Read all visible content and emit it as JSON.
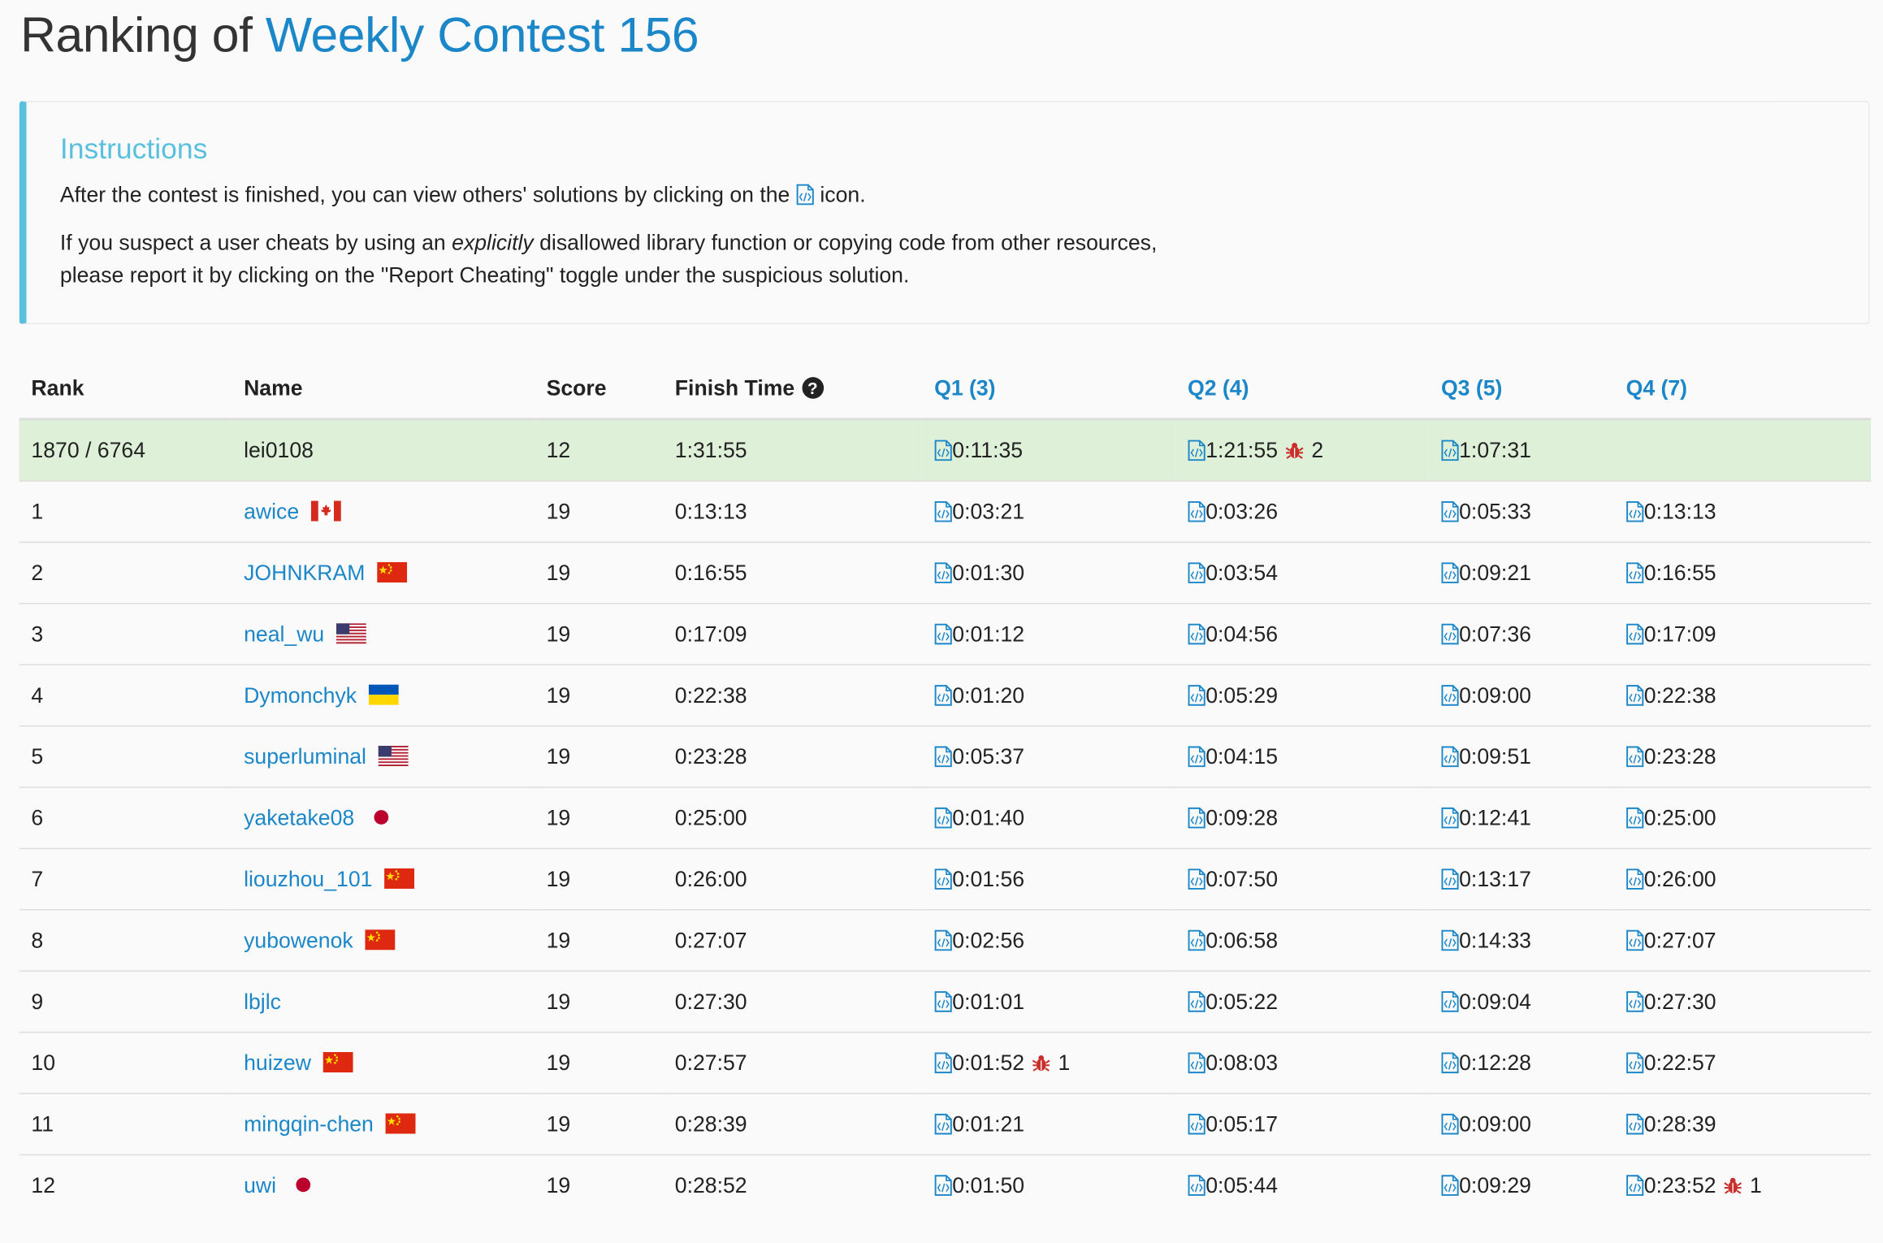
{
  "header": {
    "prefix": "Ranking of",
    "contest_name": "Weekly Contest 156"
  },
  "instructions": {
    "title": "Instructions",
    "line1_before": "After the contest is finished, you can view others' solutions by clicking on the",
    "line1_after": "icon.",
    "line2_before": "If you suspect a user cheats by using an",
    "line2_em": "explicitly",
    "line2_after": "disallowed library function or copying code from other resources,",
    "line3": "please report it by clicking on the \"Report Cheating\" toggle under the suspicious solution."
  },
  "table": {
    "headers": {
      "rank": "Rank",
      "name": "Name",
      "score": "Score",
      "finish": "Finish Time",
      "q1": "Q1 (3)",
      "q2": "Q2 (4)",
      "q3": "Q3 (5)",
      "q4": "Q4 (7)"
    },
    "rows": [
      {
        "rank": "1870 / 6764",
        "name": "lei0108",
        "flag": "",
        "score": "12",
        "finish": "1:31:55",
        "highlight": true,
        "q": [
          {
            "time": "0:11:35",
            "bugs": ""
          },
          {
            "time": "1:21:55",
            "bugs": "2"
          },
          {
            "time": "1:07:31",
            "bugs": ""
          },
          {
            "time": "",
            "bugs": ""
          }
        ]
      },
      {
        "rank": "1",
        "name": "awice",
        "flag": "ca",
        "score": "19",
        "finish": "0:13:13",
        "q": [
          {
            "time": "0:03:21",
            "bugs": ""
          },
          {
            "time": "0:03:26",
            "bugs": ""
          },
          {
            "time": "0:05:33",
            "bugs": ""
          },
          {
            "time": "0:13:13",
            "bugs": ""
          }
        ]
      },
      {
        "rank": "2",
        "name": "JOHNKRAM",
        "flag": "cn",
        "score": "19",
        "finish": "0:16:55",
        "q": [
          {
            "time": "0:01:30",
            "bugs": ""
          },
          {
            "time": "0:03:54",
            "bugs": ""
          },
          {
            "time": "0:09:21",
            "bugs": ""
          },
          {
            "time": "0:16:55",
            "bugs": ""
          }
        ]
      },
      {
        "rank": "3",
        "name": "neal_wu",
        "flag": "us",
        "score": "19",
        "finish": "0:17:09",
        "q": [
          {
            "time": "0:01:12",
            "bugs": ""
          },
          {
            "time": "0:04:56",
            "bugs": ""
          },
          {
            "time": "0:07:36",
            "bugs": ""
          },
          {
            "time": "0:17:09",
            "bugs": ""
          }
        ]
      },
      {
        "rank": "4",
        "name": "Dymonchyk",
        "flag": "ua",
        "score": "19",
        "finish": "0:22:38",
        "q": [
          {
            "time": "0:01:20",
            "bugs": ""
          },
          {
            "time": "0:05:29",
            "bugs": ""
          },
          {
            "time": "0:09:00",
            "bugs": ""
          },
          {
            "time": "0:22:38",
            "bugs": ""
          }
        ]
      },
      {
        "rank": "5",
        "name": "superluminal",
        "flag": "us",
        "score": "19",
        "finish": "0:23:28",
        "q": [
          {
            "time": "0:05:37",
            "bugs": ""
          },
          {
            "time": "0:04:15",
            "bugs": ""
          },
          {
            "time": "0:09:51",
            "bugs": ""
          },
          {
            "time": "0:23:28",
            "bugs": ""
          }
        ]
      },
      {
        "rank": "6",
        "name": "yaketake08",
        "flag": "jp",
        "score": "19",
        "finish": "0:25:00",
        "q": [
          {
            "time": "0:01:40",
            "bugs": ""
          },
          {
            "time": "0:09:28",
            "bugs": ""
          },
          {
            "time": "0:12:41",
            "bugs": ""
          },
          {
            "time": "0:25:00",
            "bugs": ""
          }
        ]
      },
      {
        "rank": "7",
        "name": "liouzhou_101",
        "flag": "cn",
        "score": "19",
        "finish": "0:26:00",
        "q": [
          {
            "time": "0:01:56",
            "bugs": ""
          },
          {
            "time": "0:07:50",
            "bugs": ""
          },
          {
            "time": "0:13:17",
            "bugs": ""
          },
          {
            "time": "0:26:00",
            "bugs": ""
          }
        ]
      },
      {
        "rank": "8",
        "name": "yubowenok",
        "flag": "cn",
        "score": "19",
        "finish": "0:27:07",
        "q": [
          {
            "time": "0:02:56",
            "bugs": ""
          },
          {
            "time": "0:06:58",
            "bugs": ""
          },
          {
            "time": "0:14:33",
            "bugs": ""
          },
          {
            "time": "0:27:07",
            "bugs": ""
          }
        ]
      },
      {
        "rank": "9",
        "name": "lbjlc",
        "flag": "",
        "score": "19",
        "finish": "0:27:30",
        "q": [
          {
            "time": "0:01:01",
            "bugs": ""
          },
          {
            "time": "0:05:22",
            "bugs": ""
          },
          {
            "time": "0:09:04",
            "bugs": ""
          },
          {
            "time": "0:27:30",
            "bugs": ""
          }
        ]
      },
      {
        "rank": "10",
        "name": "huizew",
        "flag": "cn",
        "score": "19",
        "finish": "0:27:57",
        "q": [
          {
            "time": "0:01:52",
            "bugs": "1"
          },
          {
            "time": "0:08:03",
            "bugs": ""
          },
          {
            "time": "0:12:28",
            "bugs": ""
          },
          {
            "time": "0:22:57",
            "bugs": ""
          }
        ]
      },
      {
        "rank": "11",
        "name": "mingqin-chen",
        "flag": "cn",
        "score": "19",
        "finish": "0:28:39",
        "q": [
          {
            "time": "0:01:21",
            "bugs": ""
          },
          {
            "time": "0:05:17",
            "bugs": ""
          },
          {
            "time": "0:09:00",
            "bugs": ""
          },
          {
            "time": "0:28:39",
            "bugs": ""
          }
        ]
      },
      {
        "rank": "12",
        "name": "uwi",
        "flag": "jp",
        "score": "19",
        "finish": "0:28:52",
        "q": [
          {
            "time": "0:01:50",
            "bugs": ""
          },
          {
            "time": "0:05:44",
            "bugs": ""
          },
          {
            "time": "0:09:29",
            "bugs": ""
          },
          {
            "time": "0:23:52",
            "bugs": "1"
          }
        ]
      }
    ]
  },
  "colors": {
    "link": "#1b87c9",
    "info": "#5bc0de",
    "highlight_row": "#dff0d8",
    "bug": "#c9302c"
  }
}
